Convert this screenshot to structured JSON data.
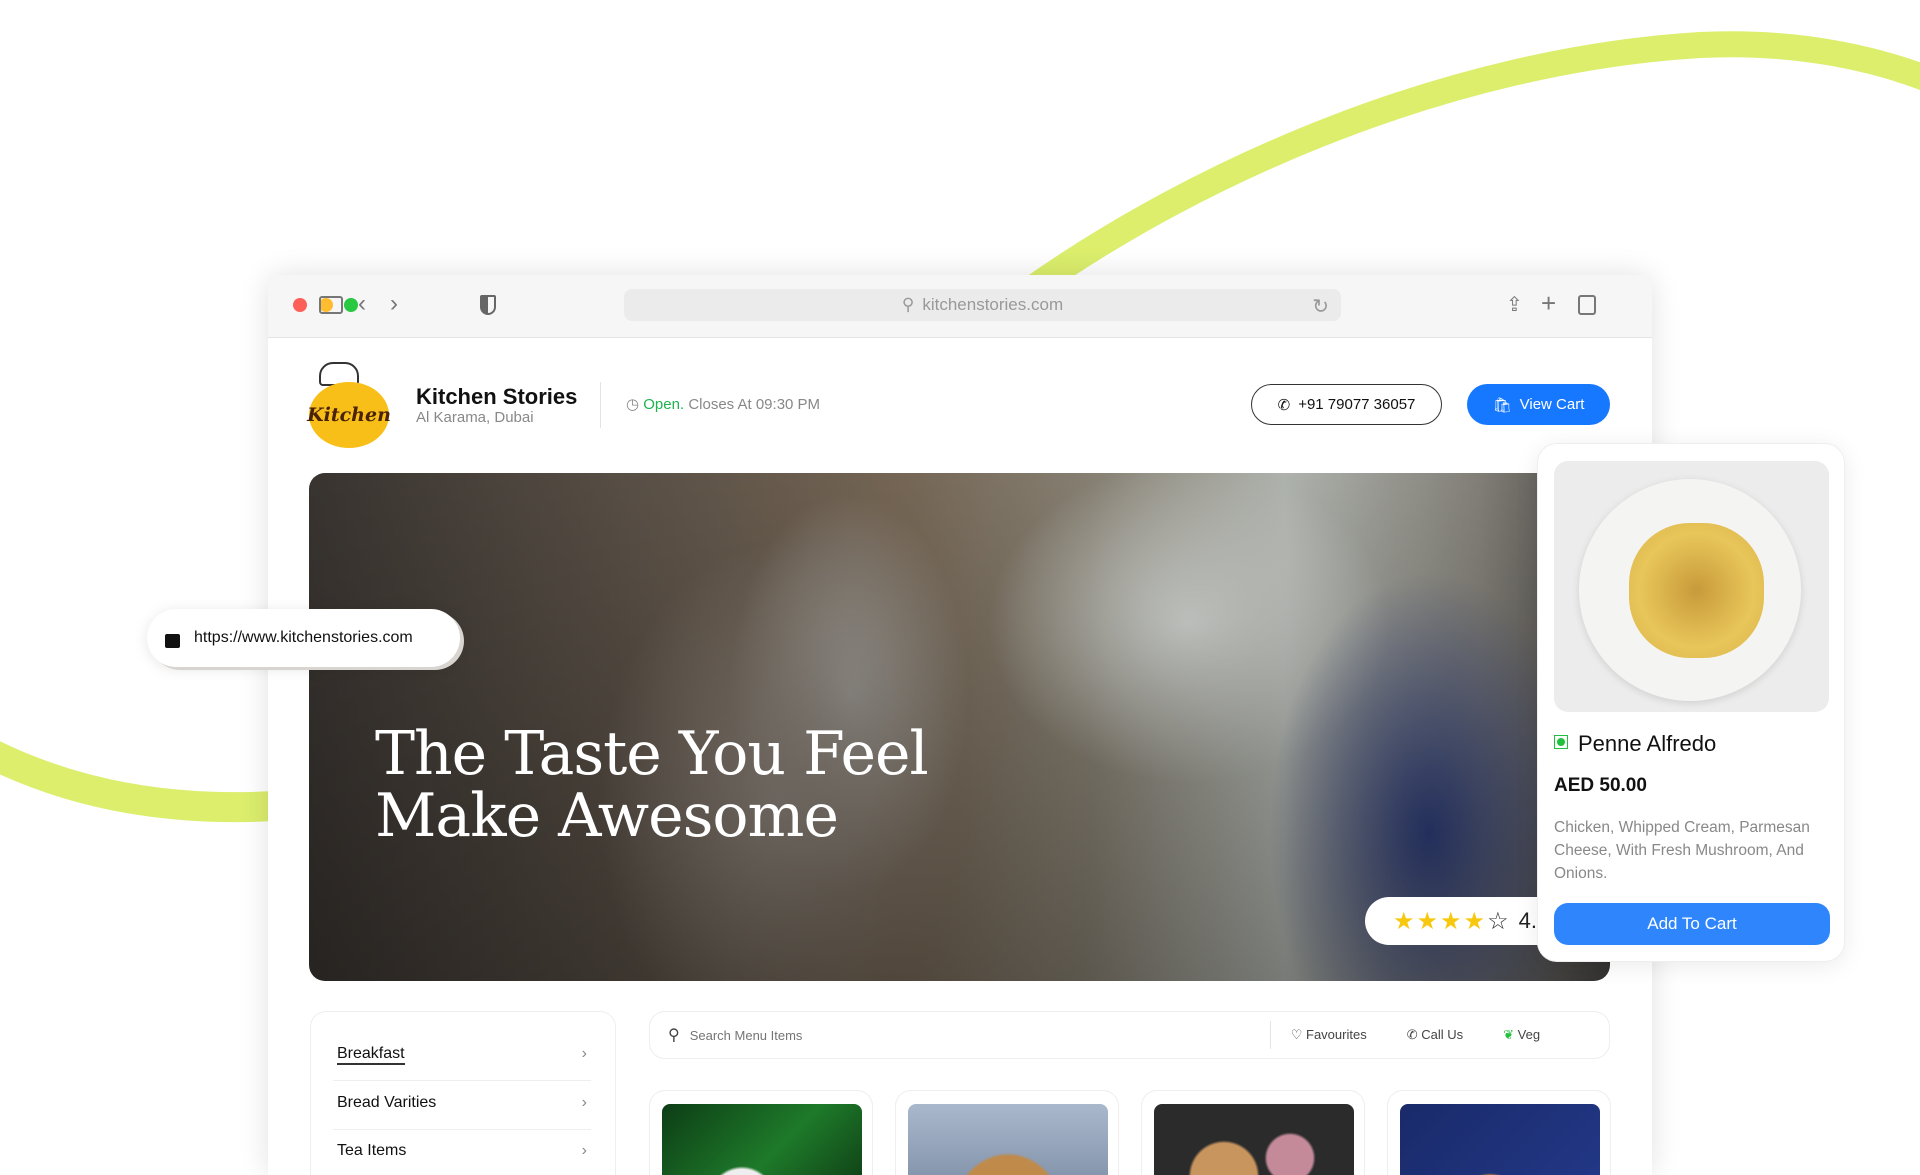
{
  "browser": {
    "url": "kitchenstories.com"
  },
  "restaurant": {
    "name": "Kitchen Stories",
    "location": "Al Karama, Dubai",
    "logo_text": "Kitchen",
    "status_open": "Open.",
    "status_closes": "Closes At 09:30 PM",
    "phone": "+91 79077 36057",
    "view_cart": "View Cart"
  },
  "hero": {
    "line1": "The Taste You Feel",
    "line2": "Make Awesome",
    "rating_text": "4.",
    "rating_stars": 4
  },
  "url_pill": {
    "url": "https://www.kitchenstories.com"
  },
  "product": {
    "name": "Penne Alfredo",
    "price": "AED 50.00",
    "description": "Chicken, Whipped Cream, Parmesan Cheese, With Fresh Mushroom, And Onions.",
    "add_to_cart": "Add To Cart",
    "veg_color": "#22c03c"
  },
  "categories": [
    {
      "label": "Breakfast",
      "active": true
    },
    {
      "label": "Bread Varities"
    },
    {
      "label": "Tea Items"
    }
  ],
  "search": {
    "placeholder": "Search Menu Items",
    "favourites": "Favourites",
    "call_us": "Call Us",
    "veg": "Veg"
  },
  "colors": {
    "accent": "#1677ff",
    "swoosh": "#dcee6c",
    "open": "#1fb34f"
  }
}
